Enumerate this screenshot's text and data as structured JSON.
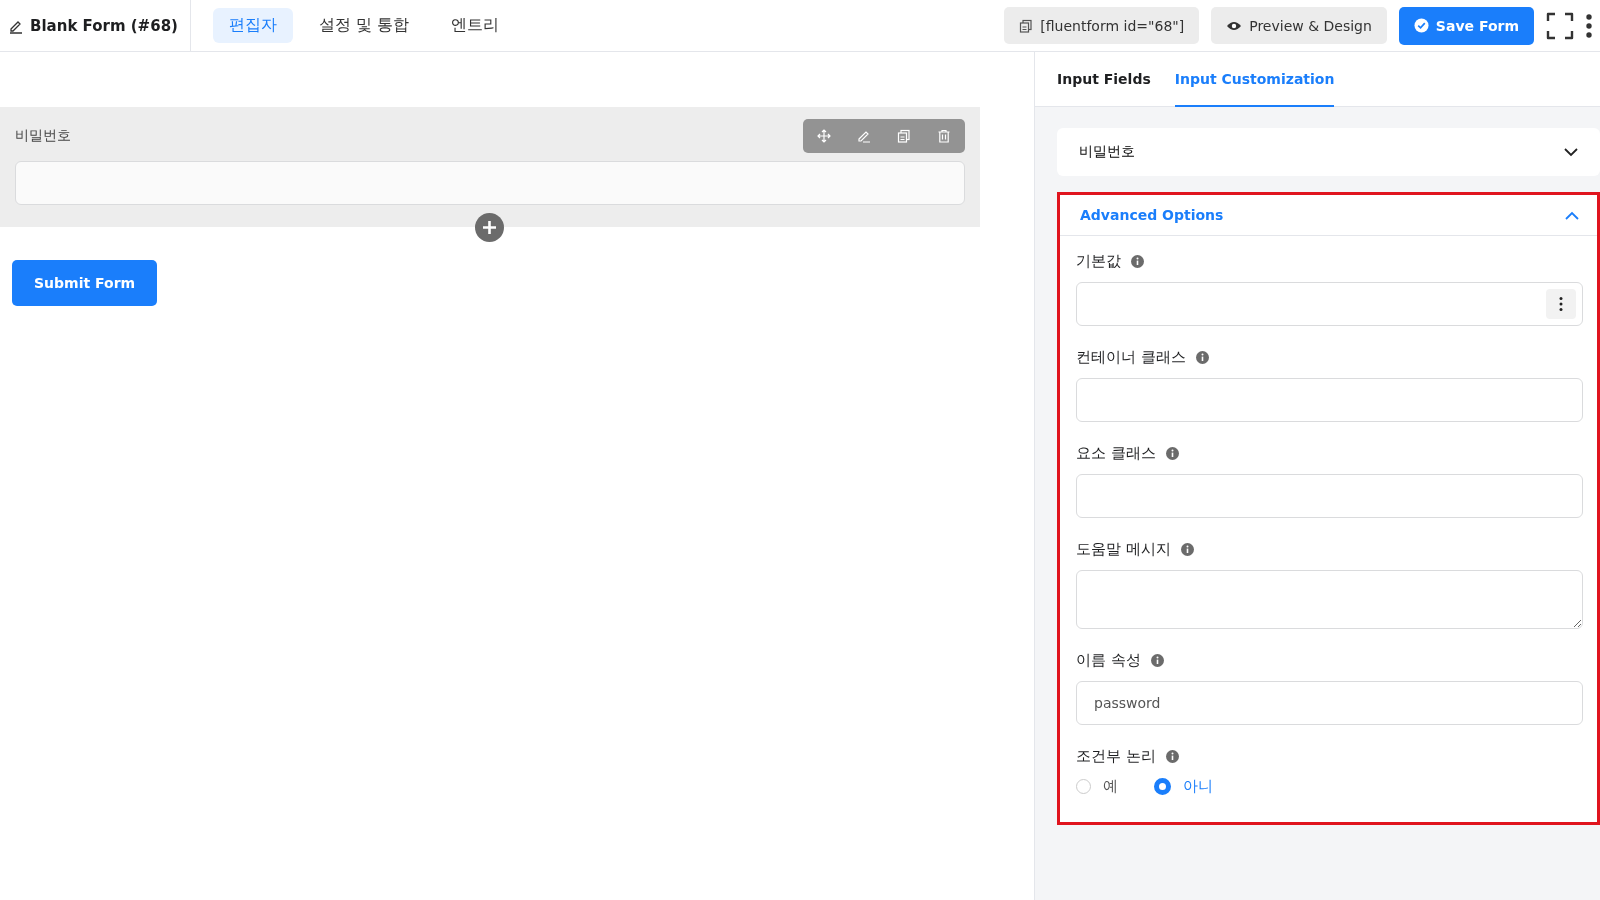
{
  "header": {
    "title": "Blank Form (#68)",
    "tabs": [
      {
        "label": "편집자",
        "selected": true
      },
      {
        "label": "설정 및 통합",
        "selected": false
      },
      {
        "label": "엔트리",
        "selected": false
      }
    ],
    "shortcode": "[fluentform id=\"68\"]",
    "preview_button": "Preview & Design",
    "save_button": "Save Form"
  },
  "canvas": {
    "field": {
      "label": "비밀번호"
    },
    "submit_button": "Submit Form"
  },
  "panel": {
    "tabs": [
      {
        "label": "Input Fields",
        "selected": false
      },
      {
        "label": "Input Customization",
        "selected": true
      }
    ],
    "field_select": "비밀번호",
    "advanced": {
      "title": "Advanced Options",
      "expanded": true,
      "fields": [
        {
          "kind": "text",
          "label": "기본값",
          "menu": true
        },
        {
          "kind": "text",
          "label": "컨테이너 클래스"
        },
        {
          "kind": "text",
          "label": "요소 클래스"
        },
        {
          "kind": "textarea",
          "label": "도움말 메시지"
        },
        {
          "kind": "text",
          "label": "이름 속성",
          "value": "password"
        },
        {
          "kind": "radio",
          "label": "조건부 논리",
          "options": [
            {
              "label": "예",
              "selected": false
            },
            {
              "label": "아니",
              "selected": true
            }
          ]
        }
      ]
    }
  }
}
